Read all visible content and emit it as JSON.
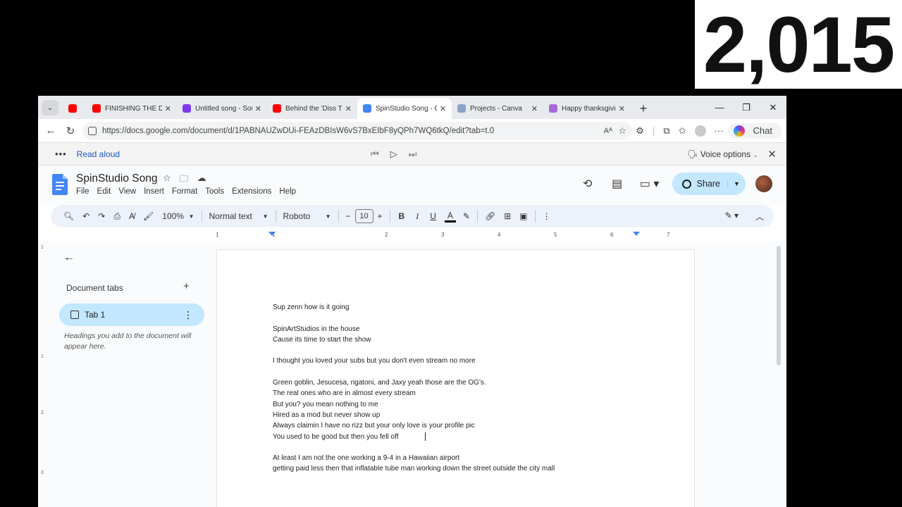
{
  "counter": "2,015",
  "browser": {
    "tabs": [
      {
        "title": "",
        "favicon_color": "#ff0000",
        "favicon": "youtube-icon",
        "active": false
      },
      {
        "title": "FINISHING THE DISS",
        "favicon_color": "#ff0000",
        "favicon": "youtube-icon",
        "active": false
      },
      {
        "title": "Untitled song - Sou",
        "favicon_color": "#7c3aed",
        "favicon": "soundtrap-icon",
        "active": false
      },
      {
        "title": "Behind the 'Diss Tra",
        "favicon_color": "#ff0000",
        "favicon": "youtube-icon",
        "active": false
      },
      {
        "title": "SpinStudio Song - G",
        "favicon_color": "#4285f4",
        "favicon": "docs-icon",
        "active": true
      },
      {
        "title": "Projects - Canva",
        "favicon_color": "#8aa4c8",
        "favicon": "canva-icon",
        "active": false
      },
      {
        "title": "Happy thanksgiving",
        "favicon_color": "#a86bd6",
        "favicon": "heart-icon",
        "active": false
      }
    ],
    "url": "https://docs.google.com/document/d/1PABNAUZwDUi-FEAzDBIsW6vS7BxEIbF8yQPh7WQ6tkQ/edit?tab=t.0",
    "copilot_label": "Chat"
  },
  "readaloud": {
    "label": "Read aloud",
    "voice_options": "Voice options"
  },
  "docs": {
    "title": "SpinStudio Song",
    "menu": [
      "File",
      "Edit",
      "View",
      "Insert",
      "Format",
      "Tools",
      "Extensions",
      "Help"
    ],
    "share_label": "Share",
    "toolbar": {
      "zoom": "100%",
      "style": "Normal text",
      "font": "Roboto",
      "font_size": "10"
    },
    "ruler_labels": [
      "1",
      "1",
      "2",
      "3",
      "4",
      "5",
      "6",
      "7"
    ],
    "vruler_labels": [
      "1",
      "1",
      "2",
      "3"
    ]
  },
  "outline": {
    "title": "Document tabs",
    "tab_label": "Tab 1",
    "hint": "Headings you add to the document will appear here."
  },
  "document_lines": [
    "Sup zenn how is it going",
    "",
    "SpinArtStudios in the house",
    "Cause its time to start the show",
    "",
    "I thought you loved your subs but you don't even stream no more",
    "",
    "Green goblin, Jesucesa, rigatoni, and Jaxy yeah those are the OG's.",
    "The real ones who are in almost every stream",
    "But you? you  mean nothing to me",
    "Hired as a mod but never show up",
    "Always claimin I have no rizz but your only love is your profile pic",
    "You used to be good but then you fell off",
    "",
    "At least I am not the one working a 9-4 in a Hawaiian airport",
    " getting paid less then that inflatable tube man working down the street outside the city mall"
  ]
}
